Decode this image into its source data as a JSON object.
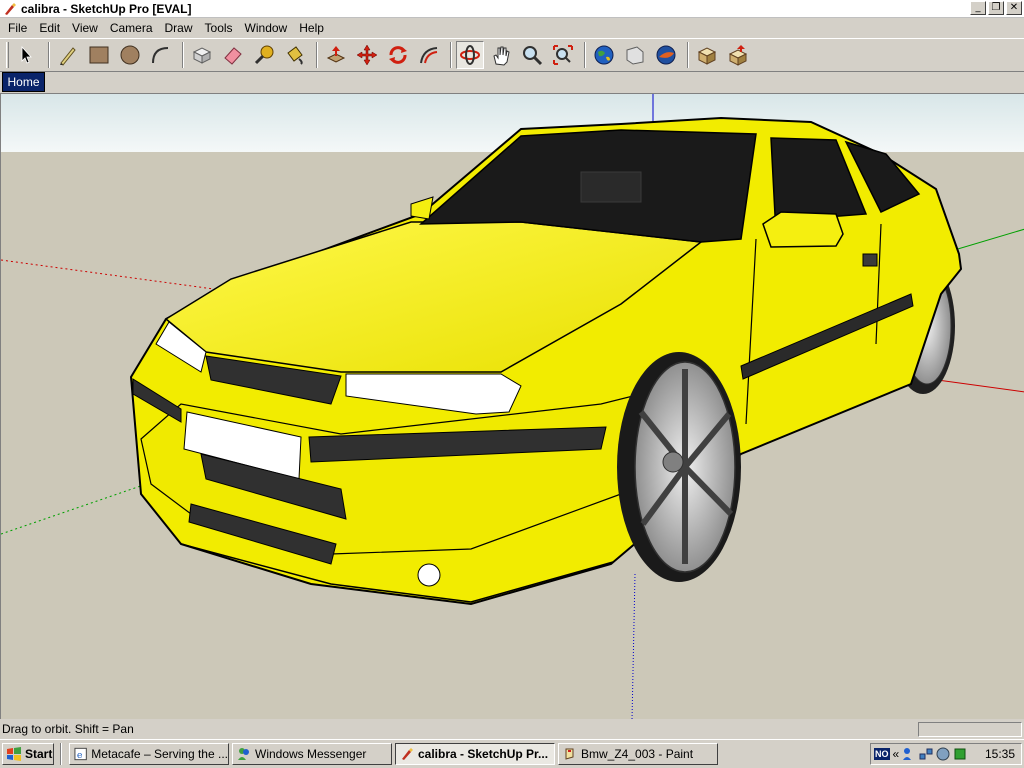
{
  "window": {
    "title": "calibra - SketchUp Pro [EVAL]",
    "controls": [
      "minimize",
      "restore",
      "close"
    ]
  },
  "menu": {
    "items": [
      "File",
      "Edit",
      "View",
      "Camera",
      "Draw",
      "Tools",
      "Window",
      "Help"
    ]
  },
  "toolbar": {
    "tools": [
      {
        "name": "select",
        "icon": "arrow-cursor-icon"
      },
      {
        "name": "line",
        "icon": "pencil-icon"
      },
      {
        "name": "rectangle",
        "icon": "rectangle-icon"
      },
      {
        "name": "circle",
        "icon": "circle-icon"
      },
      {
        "name": "arc",
        "icon": "arc-icon"
      },
      {
        "name": "make-component",
        "icon": "component-icon"
      },
      {
        "name": "eraser",
        "icon": "eraser-icon"
      },
      {
        "name": "tape-measure",
        "icon": "tape-measure-icon"
      },
      {
        "name": "paint-bucket",
        "icon": "paint-bucket-icon"
      },
      {
        "name": "push-pull",
        "icon": "push-pull-icon"
      },
      {
        "name": "move",
        "icon": "move-icon"
      },
      {
        "name": "rotate",
        "icon": "rotate-icon"
      },
      {
        "name": "offset",
        "icon": "offset-icon"
      },
      {
        "name": "orbit",
        "icon": "orbit-icon",
        "active": true
      },
      {
        "name": "pan",
        "icon": "hand-icon"
      },
      {
        "name": "zoom",
        "icon": "magnifier-icon"
      },
      {
        "name": "zoom-extents",
        "icon": "zoom-extents-icon"
      },
      {
        "name": "get-models",
        "icon": "globe-icon"
      },
      {
        "name": "share-model",
        "icon": "share-model-icon"
      },
      {
        "name": "google-earth",
        "icon": "google-earth-icon"
      },
      {
        "name": "get-components",
        "icon": "get-components-icon"
      },
      {
        "name": "share-component",
        "icon": "share-component-icon"
      }
    ]
  },
  "scene_tabs": [
    {
      "label": "Home",
      "active": true
    }
  ],
  "viewport": {
    "model": "yellow car (Opel Calibra)",
    "colors": {
      "sky": "#e6efef",
      "ground": "#ccc8b8",
      "car_body": "#f5f000",
      "axis_red": "#cc0000",
      "axis_green": "#00a000",
      "axis_blue": "#0000cc"
    }
  },
  "status": {
    "text": "Drag to orbit.  Shift = Pan",
    "measurements": ""
  },
  "taskbar": {
    "start_label": "Start",
    "buttons": [
      {
        "label": "Metacafe – Serving the ...",
        "icon": "ie-icon",
        "active": false
      },
      {
        "label": "Windows Messenger",
        "icon": "messenger-icon",
        "active": false
      },
      {
        "label": "calibra - SketchUp Pr...",
        "icon": "sketchup-icon",
        "active": true
      },
      {
        "label": "Bmw_Z4_003 - Paint",
        "icon": "paint-icon",
        "active": false
      }
    ],
    "tray": {
      "language": "NO",
      "expand": "«",
      "clock": "15:35"
    }
  }
}
